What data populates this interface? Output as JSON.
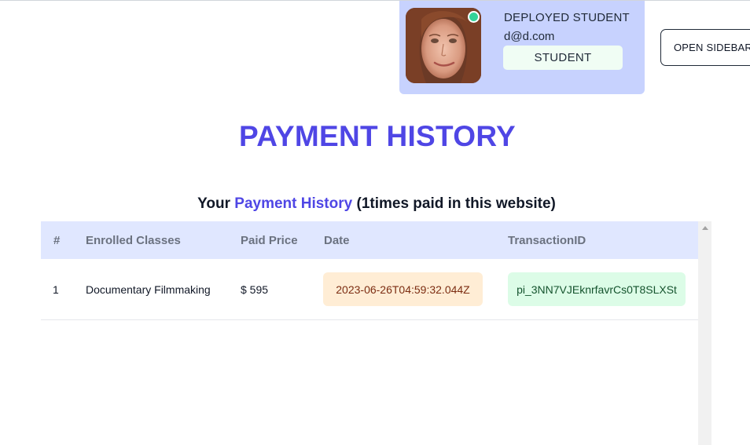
{
  "profile": {
    "name": "DEPLOYED STUDENT",
    "email": "d@d.com",
    "role": "STUDENT"
  },
  "header": {
    "sidebar_button_label": "OPEN SIDEBAR"
  },
  "page": {
    "title": "PAYMENT HISTORY",
    "subtitle_prefix": "Your",
    "subtitle_accent": "Payment History",
    "subtitle_suffix": "(1times paid in this website)"
  },
  "table": {
    "headers": [
      "#",
      "Enrolled Classes",
      "Paid Price",
      "Date",
      "TransactionID"
    ],
    "rows": [
      {
        "index": "1",
        "class_name": "Documentary Filmmaking",
        "price": "$ 595",
        "date": "2023-06-26T04:59:32.044Z",
        "transaction_id": "pi_3NN7VJEknrfavrCs0T8SLXSt"
      }
    ]
  },
  "colors": {
    "accent": "#4f46e5",
    "profile_card": "#c7d2fe",
    "table_header": "#e0e7ff",
    "online_status": "#34d399",
    "date_badge": "#ffedd5",
    "transaction_badge": "#dcfce7"
  },
  "icons": {
    "online": "online-status-dot",
    "scroll_up": "scroll-up-arrow"
  }
}
